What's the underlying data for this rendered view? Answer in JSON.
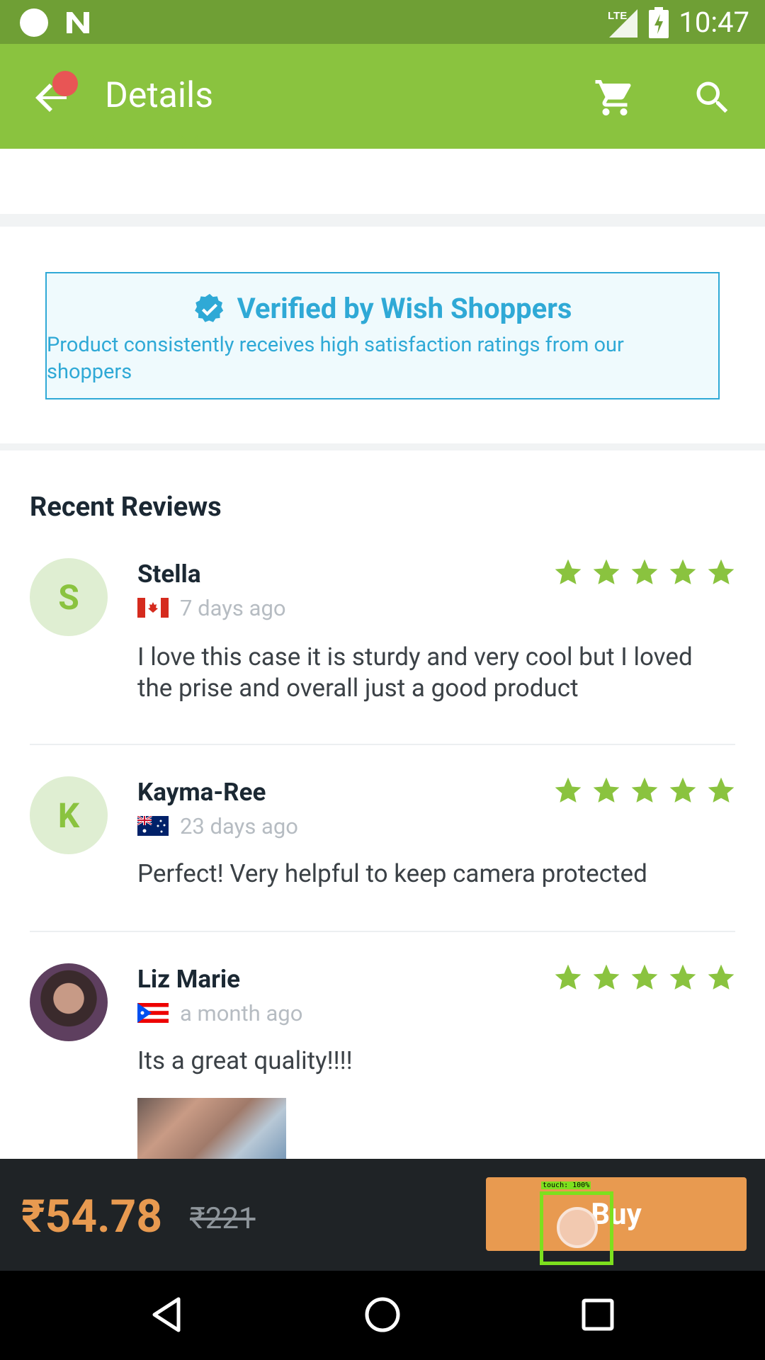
{
  "status_bar": {
    "time": "10:47",
    "network": "LTE"
  },
  "app_bar": {
    "title": "Details"
  },
  "verified": {
    "title": "Verified by Wish Shoppers",
    "description": "Product consistently receives high satisfaction ratings from our shoppers"
  },
  "reviews_section": {
    "title": "Recent Reviews"
  },
  "reviews": [
    {
      "initial": "S",
      "name": "Stella",
      "country": "Canada",
      "date": "7 days ago",
      "rating": 5,
      "text": "I love this case it is sturdy and very cool but I loved the prise and overall just a good product"
    },
    {
      "initial": "K",
      "name": "Kayma-Ree",
      "country": "Australia",
      "date": "23 days ago",
      "rating": 5,
      "text": "Perfect! Very helpful to keep camera protected"
    },
    {
      "initial": "",
      "name": "Liz Marie",
      "country": "Puerto Rico",
      "date": "a month ago",
      "rating": 5,
      "text": "Its a great quality!!!!"
    }
  ],
  "buy_bar": {
    "price": "₹54.78",
    "old_price": "₹221",
    "buy_label": "Buy"
  },
  "touch_overlay": {
    "label": "touch: 100%"
  },
  "colors": {
    "brand": "#8ac33f",
    "status_bar": "#6f9f35",
    "price": "#e89a50",
    "verified": "#2fa9d6"
  }
}
